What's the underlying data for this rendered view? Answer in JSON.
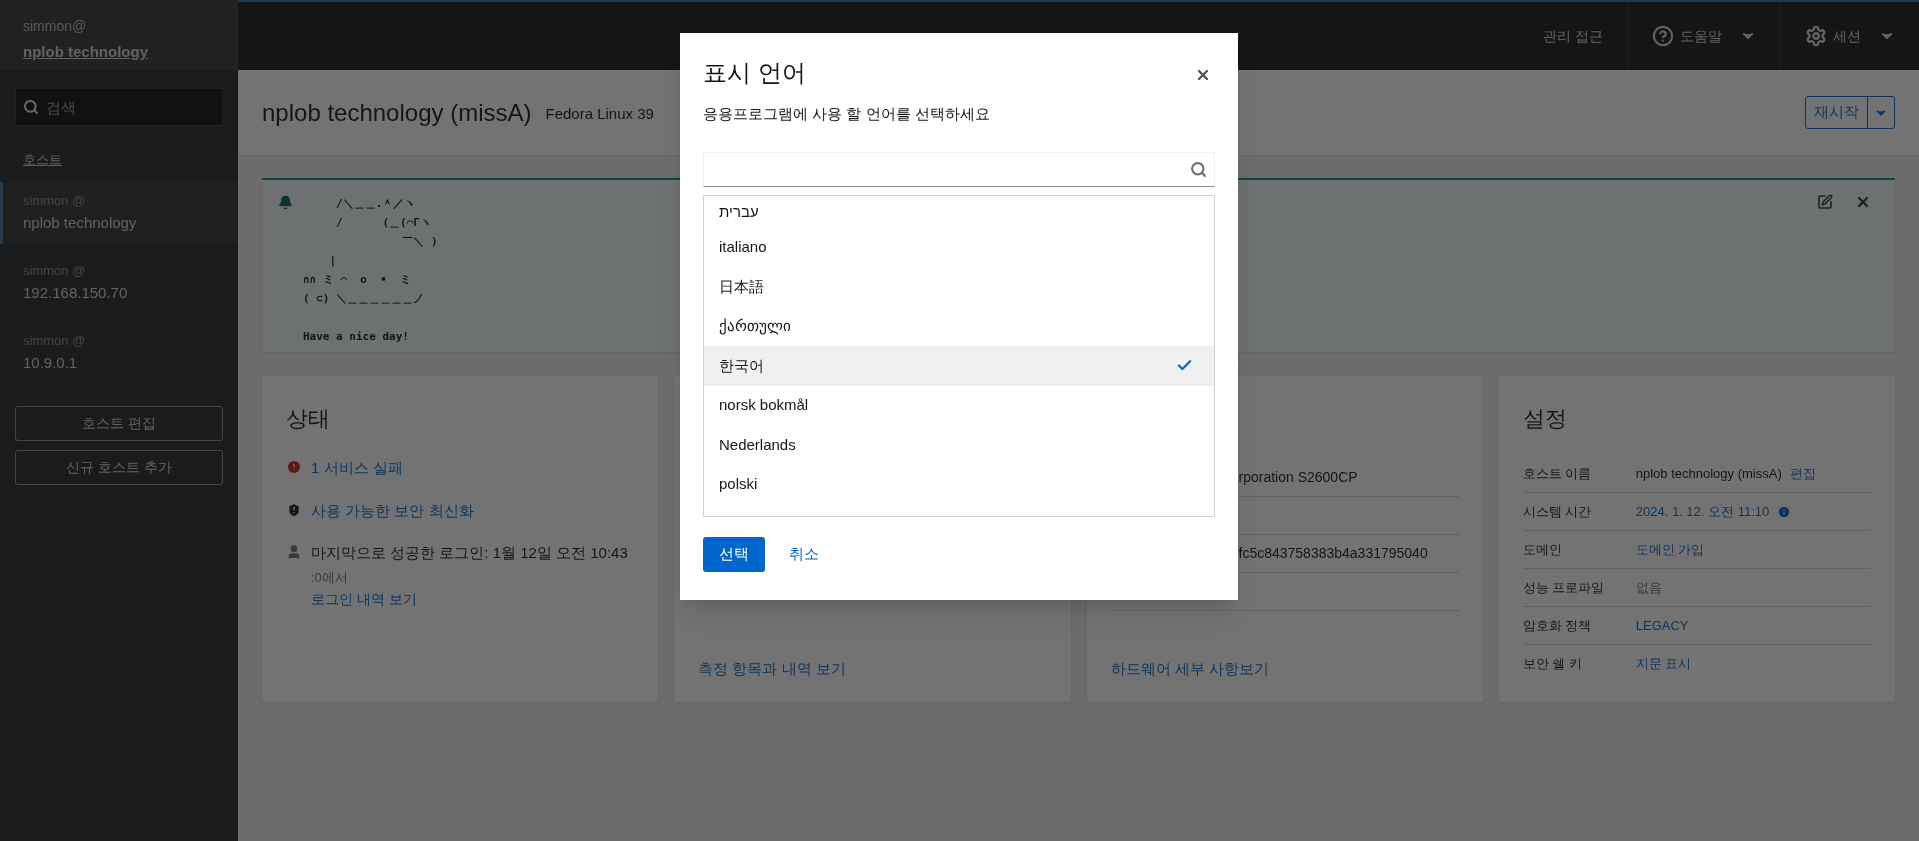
{
  "sidebar": {
    "current_user": "simmon@",
    "current_host": "nplob technology",
    "search": {
      "placeholder": "검색"
    },
    "section_title": "호스트",
    "hosts": [
      {
        "user": "simmon @",
        "host": "nplob technology",
        "selected": true
      },
      {
        "user": "simmon @",
        "host": "192.168.150.70",
        "selected": false
      },
      {
        "user": "simmon @",
        "host": "10.9.0.1",
        "selected": false
      }
    ],
    "buttons": [
      "호스트 편집",
      "신규 호스트 추가"
    ]
  },
  "topbar": {
    "items": [
      {
        "kind": "text",
        "label": "관리 접근"
      },
      {
        "kind": "help",
        "label": "도움말"
      },
      {
        "kind": "session",
        "label": "세션"
      }
    ]
  },
  "header": {
    "title": "nplob technology (missA)",
    "subtitle": "Fedora Linux 39",
    "restart_button": "재시작"
  },
  "motd": {
    "lines": [
      "     /＼＿＿.＾／ヽ",
      "     /      (＿(⌒Γヽ",
      "               ￣＼ )",
      "    |",
      "∩∩ ミ ⌒  o  •  ミ",
      "( ⊂) ＼＿＿＿＿＿＿ノ"
    ],
    "greeting": "Have a nice day!"
  },
  "status_card": {
    "title": "상태",
    "items": [
      {
        "kind": "error",
        "text": "1 서비스 실패"
      },
      {
        "kind": "security",
        "text": "사용 가능한 보안 최신화"
      },
      {
        "kind": "login",
        "text": "마지막으로 성공한 로그인: 1월 12일 오전 10:43",
        "detail": ":0에서",
        "link": "로그인 내역 보기"
      }
    ]
  },
  "usage_card": {
    "link": "측정 항목과 내역 보기"
  },
  "hardware_card": {
    "rows": [
      {
        "value": "rporation S2600CP"
      },
      {},
      {
        "value": "fc5c843758383b4a331795040"
      },
      {}
    ],
    "link": "하드웨어 세부 사항보기"
  },
  "settings_card": {
    "title": "설정",
    "rows": [
      {
        "label": "호스트 이름",
        "value": "nplob technology (missA)",
        "kind": "text",
        "action": "편집"
      },
      {
        "label": "시스템 시간",
        "value": "2024. 1. 12. 오전 11:10",
        "kind": "link",
        "info": true
      },
      {
        "label": "도메인",
        "value": "도메인 가입",
        "kind": "link"
      },
      {
        "label": "성능 프로파일",
        "value": "없음",
        "kind": "muted"
      },
      {
        "label": "암호화 정책",
        "value": "LEGACY",
        "kind": "link"
      },
      {
        "label": "보안 쉘 키",
        "value": "지문 표시",
        "kind": "link"
      }
    ]
  },
  "dialog": {
    "title": "표시 언어",
    "description": "응용프로그램에 사용 할 언어를 선택하세요",
    "languages": [
      {
        "label": "עברית",
        "selected": false
      },
      {
        "label": "italiano",
        "selected": false
      },
      {
        "label": "日本語",
        "selected": false
      },
      {
        "label": "ქართული",
        "selected": false
      },
      {
        "label": "한국어",
        "selected": true
      },
      {
        "label": "norsk bokmål",
        "selected": false
      },
      {
        "label": "Nederlands",
        "selected": false
      },
      {
        "label": "polski",
        "selected": false
      }
    ],
    "primary_button": "선택",
    "cancel_link": "취소"
  }
}
